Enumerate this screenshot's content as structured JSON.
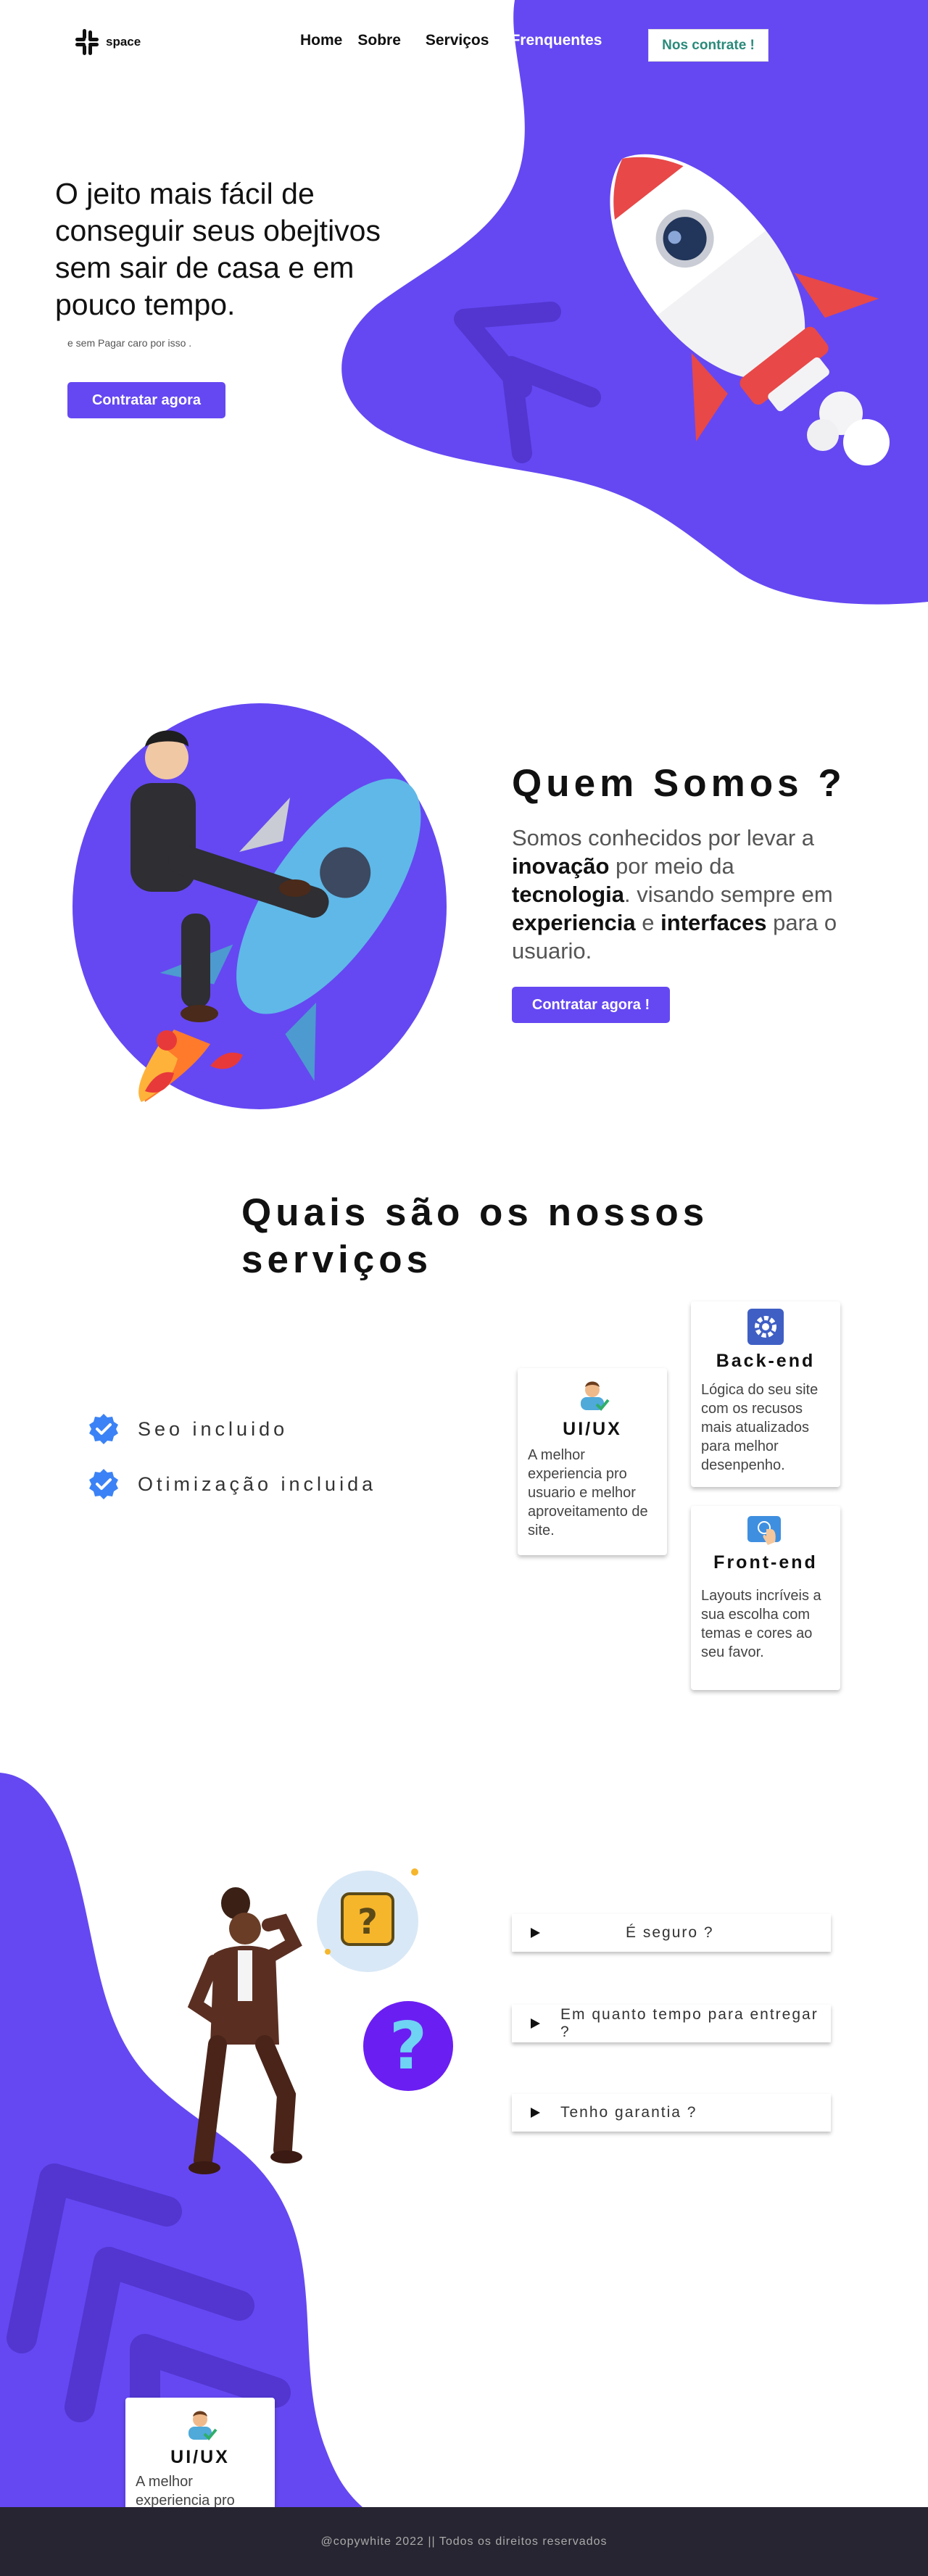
{
  "brand": {
    "name": "space"
  },
  "nav": {
    "items": [
      {
        "label": "Home"
      },
      {
        "label": "Sobre"
      },
      {
        "label": "Serviços"
      },
      {
        "label": "Frenquentes"
      }
    ],
    "cta_label": "Nos contrate !"
  },
  "hero": {
    "title": "O jeito mais fácil de conseguir seus obejtivos sem sair de casa e em pouco tempo.",
    "subtitle": "e sem Pagar caro por isso .",
    "button_label": "Contratar agora"
  },
  "about": {
    "heading": "Quem Somos ?",
    "text_parts": [
      "Somos conhecidos por levar a ",
      "inovação",
      " por meio da ",
      "tecnologia",
      ". visando sempre em ",
      "experiencia",
      " e ",
      "interfaces",
      " para o usuario."
    ],
    "button_label": "Contratar agora !"
  },
  "services": {
    "heading": "Quais são os nossos serviços",
    "features": [
      {
        "label": "Seo incluido",
        "icon": "verified-check-icon"
      },
      {
        "label": "Otimização incluida",
        "icon": "verified-check-icon"
      }
    ],
    "cards": [
      {
        "title": "Back-end",
        "icon": "gear-icon",
        "description": "Lógica do seu site com os recusos mais atualizados para melhor desenpenho."
      },
      {
        "title": "UI/UX",
        "icon": "designer-avatar-icon",
        "description": "A  melhor experiencia pro usuario e melhor aproveitamento de site."
      },
      {
        "title": "Front-end",
        "icon": "touch-screen-icon",
        "description": "Layouts incríveis a sua escolha com temas e cores ao seu favor."
      }
    ],
    "extra_card": {
      "title": "UI/UX",
      "description": "A  melhor experiencia pro"
    }
  },
  "faq": {
    "items": [
      {
        "question": "É seguro ?"
      },
      {
        "question": "Em quanto tempo para entregar ?"
      },
      {
        "question": "Tenho garantia ?"
      }
    ]
  },
  "footer": {
    "text": "@copywhite 2022 || Todos os direitos reservados"
  },
  "colors": {
    "accent": "#6548f2",
    "footer_bg": "#272531",
    "check_blue": "#3b82f6"
  }
}
